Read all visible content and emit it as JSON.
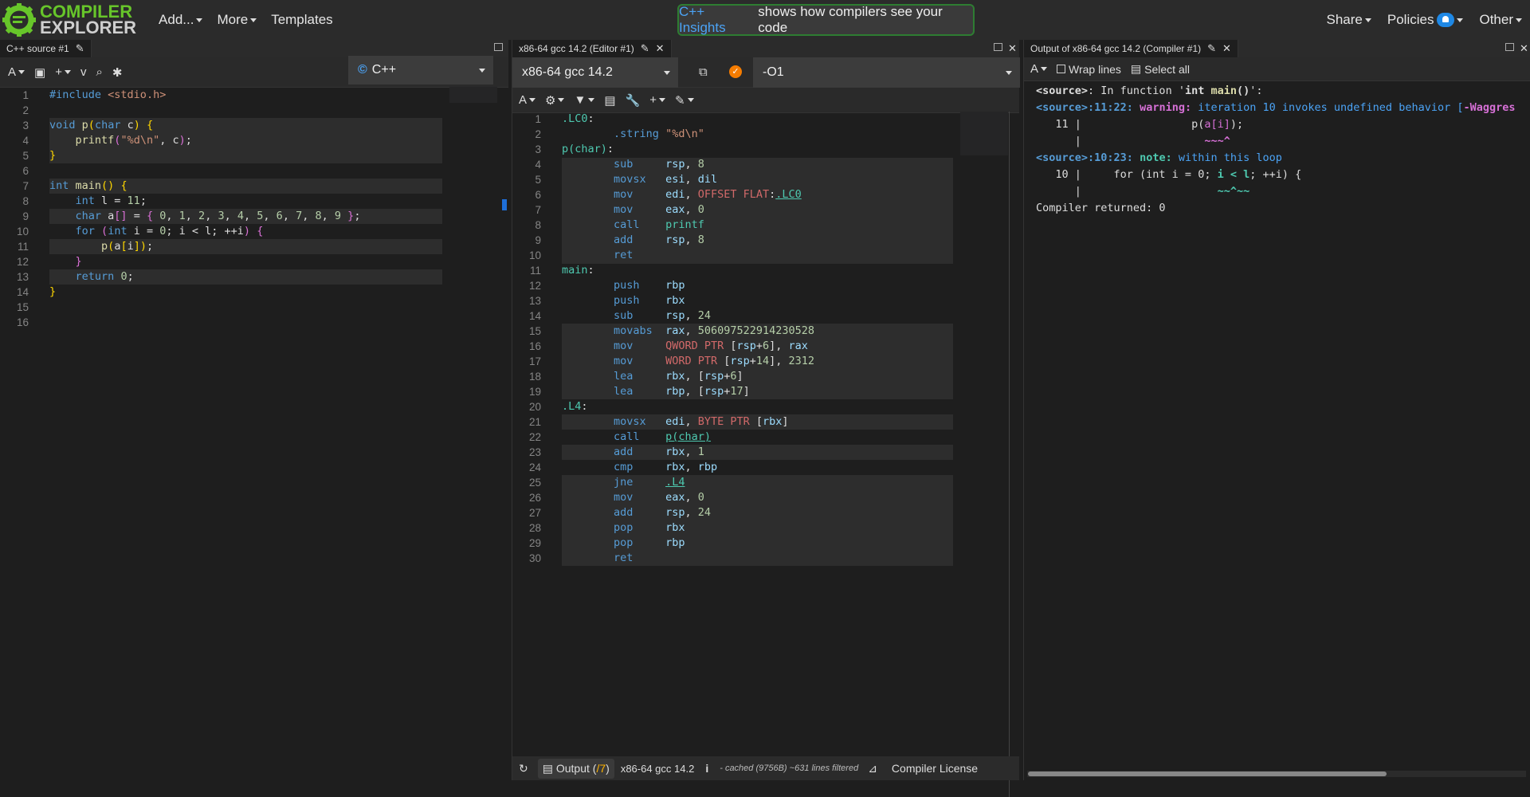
{
  "brand": {
    "line1": "COMPILER",
    "line2": "EXPLORER",
    "color": "#67c52a"
  },
  "nav": {
    "add": "Add...",
    "more": "More",
    "templates": "Templates",
    "share": "Share",
    "policies": "Policies",
    "other": "Other"
  },
  "insights": {
    "link": "C++ Insights",
    "text": "shows how compilers see your code"
  },
  "editor": {
    "tab": "C++ source #1",
    "language": "C++",
    "lines": [
      "1",
      "2",
      "3",
      "4",
      "5",
      "6",
      "7",
      "8",
      "9",
      "10",
      "11",
      "12",
      "13",
      "14",
      "15",
      "16"
    ]
  },
  "compiler": {
    "tab": "x86-64 gcc 14.2 (Editor #1)",
    "name": "x86-64 gcc 14.2",
    "options": "-O1",
    "lines": [
      "1",
      "2",
      "3",
      "4",
      "5",
      "6",
      "7",
      "8",
      "9",
      "10",
      "11",
      "12",
      "13",
      "14",
      "15",
      "16",
      "17",
      "18",
      "19",
      "20",
      "21",
      "22",
      "23",
      "24",
      "25",
      "26",
      "27",
      "28",
      "29",
      "30"
    ],
    "status": {
      "output": "Output (",
      "output_count": "/7",
      "output_end": ")",
      "compiler": "x86-64 gcc 14.2",
      "info": "i",
      "cached": "- cached (9756B) ~631 lines filtered",
      "license": "Compiler License"
    }
  },
  "output": {
    "tab": "Output of x86-64 gcc 14.2 (Compiler #1)",
    "wrap": "Wrap lines",
    "select_all": "Select all",
    "returned": "Compiler returned: 0"
  }
}
